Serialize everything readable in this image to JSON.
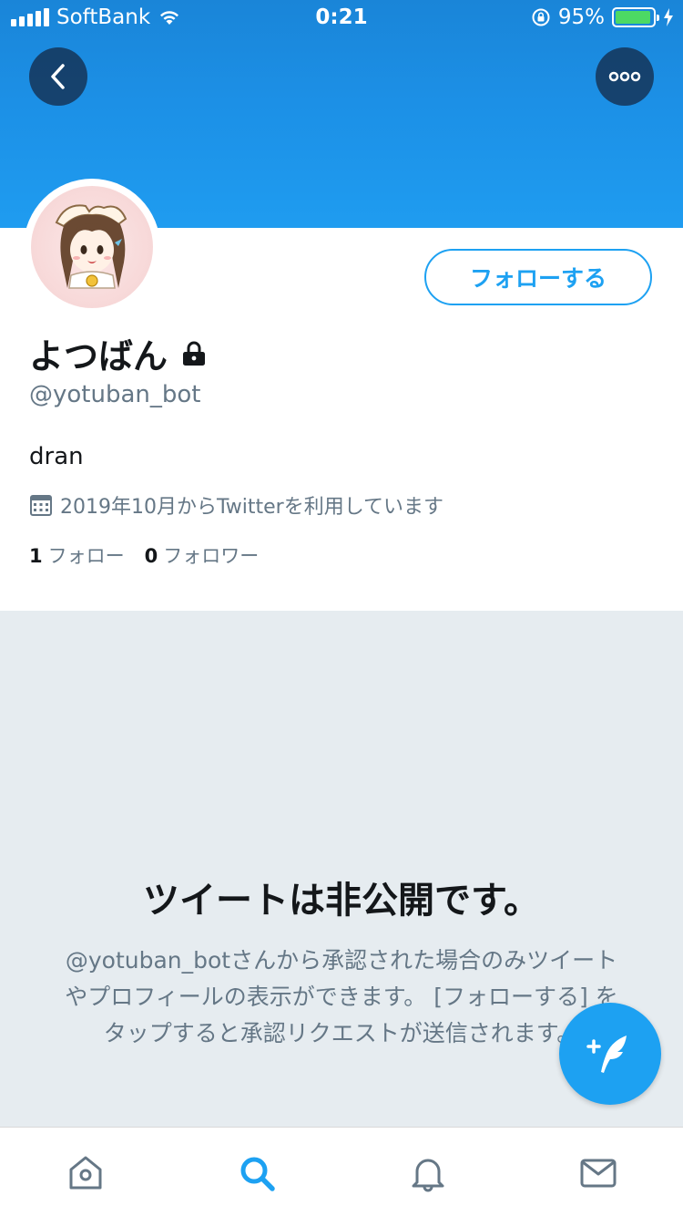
{
  "status_bar": {
    "carrier": "SoftBank",
    "time": "0:21",
    "battery_percent": "95%",
    "battery_level": 0.95
  },
  "profile": {
    "name": "よつばん",
    "handle": "@yotuban_bot",
    "bio": "dran",
    "joined": "2019年10月からTwitterを利用しています",
    "following_count": "1",
    "following_label": "フォロー",
    "followers_count": "0",
    "followers_label": "フォロワー",
    "follow_button_label": "フォローする",
    "protected": true
  },
  "private_notice": {
    "title": "ツイートは非公開です。",
    "description": "@yotuban_botさんから承認された場合のみツイートやプロフィールの表示ができます。 [フォローする] をタップすると承認リクエストが送信されます。"
  },
  "colors": {
    "accent": "#1da1f2",
    "banner": "#1c90e6",
    "muted_text": "#657786",
    "private_bg": "#e6ecf0"
  },
  "icons": {
    "back": "chevron-left-icon",
    "more": "more-dots-icon",
    "lock": "lock-icon",
    "calendar": "calendar-icon",
    "compose": "compose-tweet-icon",
    "tabs": [
      "home-icon",
      "search-icon",
      "notifications-icon",
      "messages-icon"
    ]
  }
}
